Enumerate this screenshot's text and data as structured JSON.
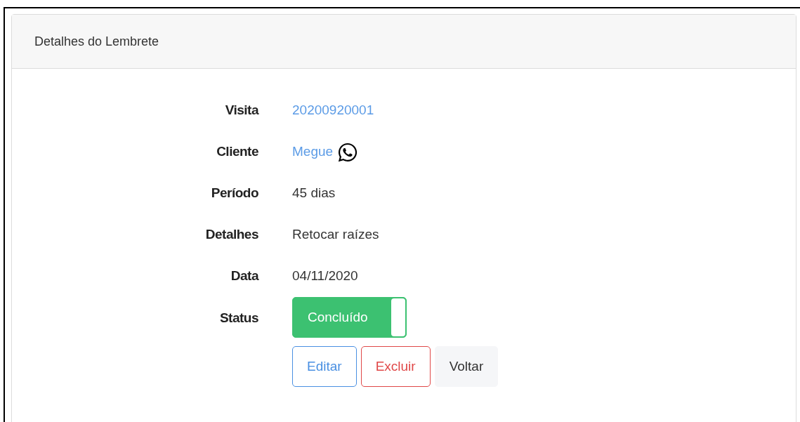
{
  "card": {
    "title": "Detalhes do Lembrete"
  },
  "fields": [
    {
      "label": "Visita",
      "kind": "link",
      "value": "20200920001"
    },
    {
      "label": "Cliente",
      "kind": "contact",
      "value": "Megue"
    },
    {
      "label": "Período",
      "kind": "text",
      "value": "45 dias"
    },
    {
      "label": "Detalhes",
      "kind": "text",
      "value": "Retocar raízes"
    },
    {
      "label": "Data",
      "kind": "text",
      "value": "04/11/2020"
    },
    {
      "label": "Status",
      "kind": "toggle",
      "value": "Concluído",
      "on": true
    }
  ],
  "buttons": [
    {
      "label": "Editar",
      "kind": "primary"
    },
    {
      "label": "Excluir",
      "kind": "danger"
    },
    {
      "label": "Voltar",
      "kind": "secondary"
    }
  ]
}
